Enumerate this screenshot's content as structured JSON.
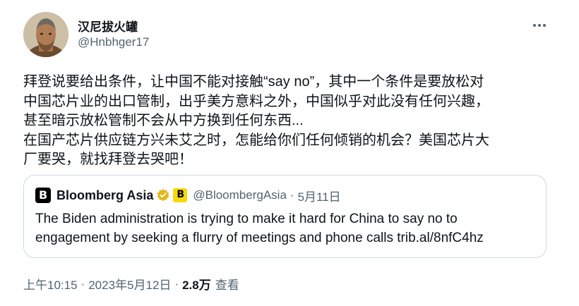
{
  "author": {
    "display_name": "汉尼拔火罐",
    "handle": "@Hnbhger17"
  },
  "tweet": {
    "lines": [
      "拜登说要给出条件，让中国不能对接触“say no”，其中一个条件是要放松对",
      "中国芯片业的出口管制，出乎美方意料之外，中国似乎对此没有任何兴趣，",
      "甚至暗示放松管制不会从中方换到任何东西...",
      "在国产芯片供应链方兴未艾之时，怎能给你们任何倾销的机会？美国芯片大",
      "厂要哭，就找拜登去哭吧！"
    ]
  },
  "quote": {
    "logo_letter": "B",
    "name": "Bloomberg Asia",
    "badge_letter": "B",
    "handle": "@BloombergAsia",
    "separator": "·",
    "date": "5月11日",
    "lines": [
      "The Biden administration is trying to make it hard for China to say no to",
      "engagement by seeking a flurry of meetings and phone calls trib.al/8nfC4hz"
    ]
  },
  "meta": {
    "time": "上午10:15",
    "separator": "·",
    "date": "2023年5月12日",
    "views_count": "2.8万",
    "views_label": "查看"
  },
  "colors": {
    "text": "#0f1419",
    "secondary": "#536471",
    "border": "#cfd9de",
    "verified_gold": "#e2b719",
    "bloomberg_yellow": "#f5d90a"
  },
  "icons": {
    "more": "more-horizontal-icon",
    "verified": "verified-badge-icon"
  }
}
